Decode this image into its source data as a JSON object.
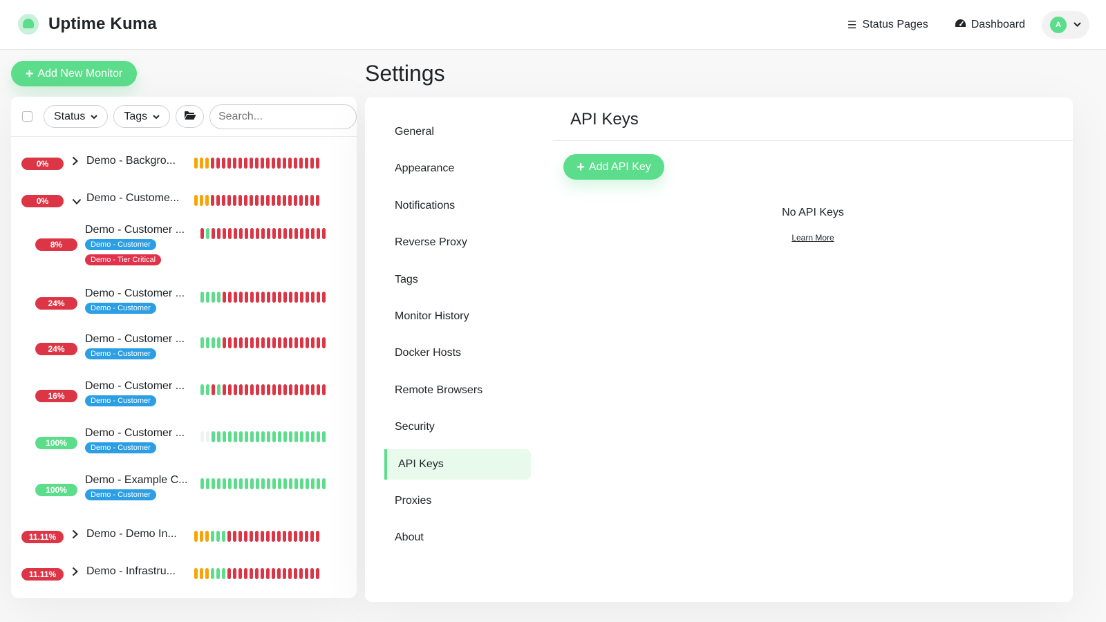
{
  "header": {
    "app_title": "Uptime Kuma",
    "nav": [
      {
        "label": "Status Pages",
        "icon": "list-icon"
      },
      {
        "label": "Dashboard",
        "icon": "tachometer-icon"
      }
    ],
    "avatar_initial": "A"
  },
  "toolbar": {
    "add_monitor_label": "Add New Monitor",
    "status_filter_label": "Status",
    "tags_filter_label": "Tags",
    "search_placeholder": "Search..."
  },
  "monitors": [
    {
      "uptime": "0%",
      "status": "red",
      "name": "Demo - Backgro...",
      "expander": "collapsed",
      "indent": 0,
      "tags": [],
      "heartbeats": "ooorrrrrrrrrrrrrrrrrrrr"
    },
    {
      "uptime": "0%",
      "status": "red",
      "name": "Demo - Custome...",
      "expander": "expanded",
      "indent": 0,
      "tags": [],
      "heartbeats": "ooorrrrrrrrrrrrrrrrrrrr"
    },
    {
      "uptime": "8%",
      "status": "red",
      "name": "Demo - Customer ...",
      "expander": "none",
      "indent": 1,
      "tags": [
        {
          "label": "Demo - Customer",
          "color": "#2c9fe4"
        },
        {
          "label": "Demo - Tier Critical",
          "color": "#e0324a"
        }
      ],
      "heartbeats": "rgrrrrrrrrrrrrrrrrrrrrr"
    },
    {
      "uptime": "24%",
      "status": "red",
      "name": "Demo - Customer ...",
      "expander": "none",
      "indent": 1,
      "tags": [
        {
          "label": "Demo - Customer",
          "color": "#2c9fe4"
        }
      ],
      "heartbeats": "ggggrrrrrrrrrrrrrrrrrrr"
    },
    {
      "uptime": "24%",
      "status": "red",
      "name": "Demo - Customer ...",
      "expander": "none",
      "indent": 1,
      "tags": [
        {
          "label": "Demo - Customer",
          "color": "#2c9fe4"
        }
      ],
      "heartbeats": "ggggrrrrrrrrrrrrrrrrrrr"
    },
    {
      "uptime": "16%",
      "status": "red",
      "name": "Demo - Customer ...",
      "expander": "none",
      "indent": 1,
      "tags": [
        {
          "label": "Demo - Customer",
          "color": "#2c9fe4"
        }
      ],
      "heartbeats": "ggrgrrrrrrrrrrrrrrrrrrr"
    },
    {
      "uptime": "100%",
      "status": "green",
      "name": "Demo - Customer ...",
      "expander": "none",
      "indent": 1,
      "tags": [
        {
          "label": "Demo - Customer",
          "color": "#2c9fe4"
        }
      ],
      "heartbeats": "eeggggggggggggggggggggg"
    },
    {
      "uptime": "100%",
      "status": "green",
      "name": "Demo - Example C...",
      "expander": "none",
      "indent": 1,
      "tags": [
        {
          "label": "Demo - Customer",
          "color": "#2c9fe4"
        }
      ],
      "heartbeats": "ggggggggggggggggggggggg"
    },
    {
      "uptime": "11.11%",
      "status": "red",
      "name": "Demo - Demo In...",
      "expander": "collapsed",
      "indent": 0,
      "tags": [],
      "heartbeats": "ooogggrrrrrrrrrrrrrrrrr"
    },
    {
      "uptime": "11.11%",
      "status": "red",
      "name": "Demo - Infrastru...",
      "expander": "collapsed",
      "indent": 0,
      "tags": [],
      "heartbeats": "ooogggrrrrrrrrrrrrrrrrr"
    }
  ],
  "settings": {
    "title": "Settings",
    "menu": [
      "General",
      "Appearance",
      "Notifications",
      "Reverse Proxy",
      "Tags",
      "Monitor History",
      "Docker Hosts",
      "Remote Browsers",
      "Security",
      "API Keys",
      "Proxies",
      "About"
    ],
    "active_menu": "API Keys",
    "content": {
      "title": "API Keys",
      "add_button_label": "Add API Key",
      "empty_text": "No API Keys",
      "learn_more_label": "Learn More"
    }
  },
  "colors": {
    "accent": "#5cdd8b",
    "danger": "#dc3545",
    "warning": "#f8a306",
    "tag_blue": "#2c9fe4"
  }
}
